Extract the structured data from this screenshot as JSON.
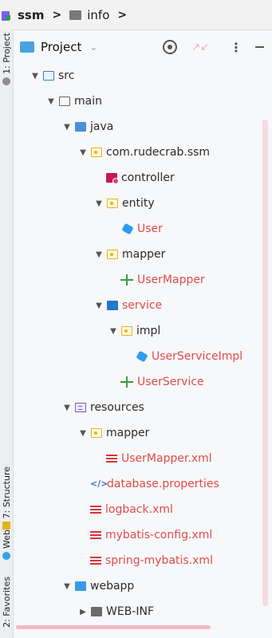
{
  "breadcrumb": {
    "project": "ssm",
    "folder": "info"
  },
  "stripe": {
    "project_tab": "1: Project",
    "structure_tab": "7: Structure",
    "web_tab": "Web",
    "favorites_tab": "2: Favorites"
  },
  "panel": {
    "title": "Project"
  },
  "tree": [
    {
      "label": "src",
      "icon": "source-folder-icon",
      "chevron": "expanded",
      "style": "normal"
    },
    {
      "label": "main",
      "icon": "folder-icon",
      "chevron": "expanded",
      "style": "normal"
    },
    {
      "label": "java",
      "icon": "java-folder-icon",
      "chevron": "expanded",
      "style": "normal"
    },
    {
      "label": "com.rudecrab.ssm",
      "icon": "package-icon",
      "chevron": "expanded",
      "style": "normal"
    },
    {
      "label": "controller",
      "icon": "controller-package-icon",
      "chevron": "none",
      "style": "normal"
    },
    {
      "label": "entity",
      "icon": "package-icon",
      "chevron": "expanded",
      "style": "normal"
    },
    {
      "label": "User",
      "icon": "class-icon",
      "chevron": "none",
      "style": "modified"
    },
    {
      "label": "mapper",
      "icon": "package-icon",
      "chevron": "expanded",
      "style": "normal"
    },
    {
      "label": "UserMapper",
      "icon": "interface-icon",
      "chevron": "none",
      "style": "modified"
    },
    {
      "label": "service",
      "icon": "service-package-icon",
      "chevron": "expanded",
      "style": "modified"
    },
    {
      "label": "impl",
      "icon": "package-icon",
      "chevron": "expanded",
      "style": "normal"
    },
    {
      "label": "UserServiceImpl",
      "icon": "class-icon",
      "chevron": "none",
      "style": "modified"
    },
    {
      "label": "UserService",
      "icon": "interface-icon",
      "chevron": "none",
      "style": "modified"
    },
    {
      "label": "resources",
      "icon": "resources-folder-icon",
      "chevron": "expanded",
      "style": "normal"
    },
    {
      "label": "mapper",
      "icon": "package-icon",
      "chevron": "expanded",
      "style": "normal"
    },
    {
      "label": "UserMapper.xml",
      "icon": "xml-file-icon",
      "chevron": "none",
      "style": "modified"
    },
    {
      "label": "database.properties",
      "icon": "properties-file-icon",
      "chevron": "none",
      "style": "modified"
    },
    {
      "label": "logback.xml",
      "icon": "xml-file-icon",
      "chevron": "none",
      "style": "modified"
    },
    {
      "label": "mybatis-config.xml",
      "icon": "xml-file-icon",
      "chevron": "none",
      "style": "modified"
    },
    {
      "label": "spring-mybatis.xml",
      "icon": "xml-file-icon",
      "chevron": "none",
      "style": "modified"
    },
    {
      "label": "webapp",
      "icon": "web-folder-icon",
      "chevron": "expanded",
      "style": "normal"
    },
    {
      "label": "WEB-INF",
      "icon": "folder-icon",
      "chevron": "collapsed",
      "style": "normal"
    }
  ],
  "colors": {
    "modified_text": "#e24a4a",
    "accent": "#4a90d9"
  }
}
